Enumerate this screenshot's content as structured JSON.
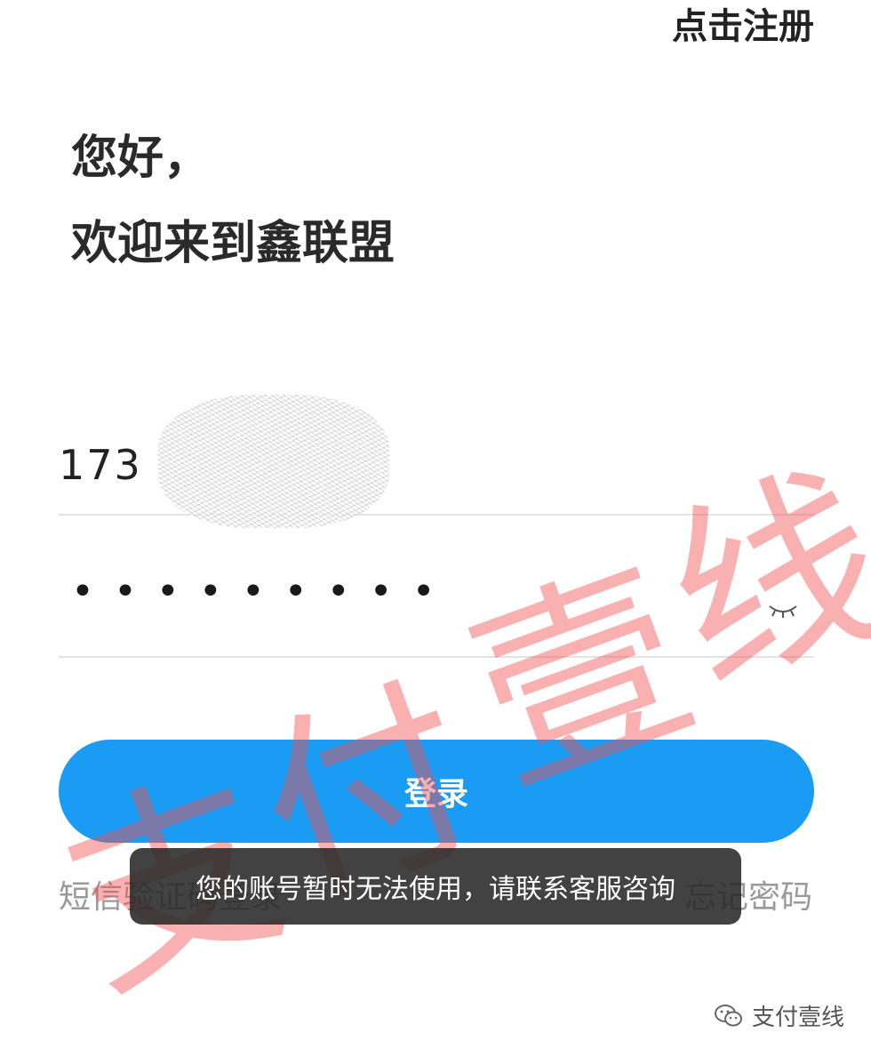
{
  "header": {
    "register_label": "点击注册"
  },
  "greeting": {
    "line1": "您好，",
    "line2": "欢迎来到鑫联盟"
  },
  "phone": {
    "value": "173"
  },
  "password": {
    "masked_value": "•••••••••"
  },
  "login": {
    "button_label": "登录"
  },
  "links": {
    "sms_login": "短信验证码登录",
    "forgot_password": "忘记密码"
  },
  "toast": {
    "message": "您的账号暂时无法使用，请联系客服咨询"
  },
  "watermark": {
    "chars": [
      "支",
      "付",
      "壹",
      "线"
    ]
  },
  "footer": {
    "badge_text": "支付壹线",
    "icon": "wechat-icon"
  }
}
